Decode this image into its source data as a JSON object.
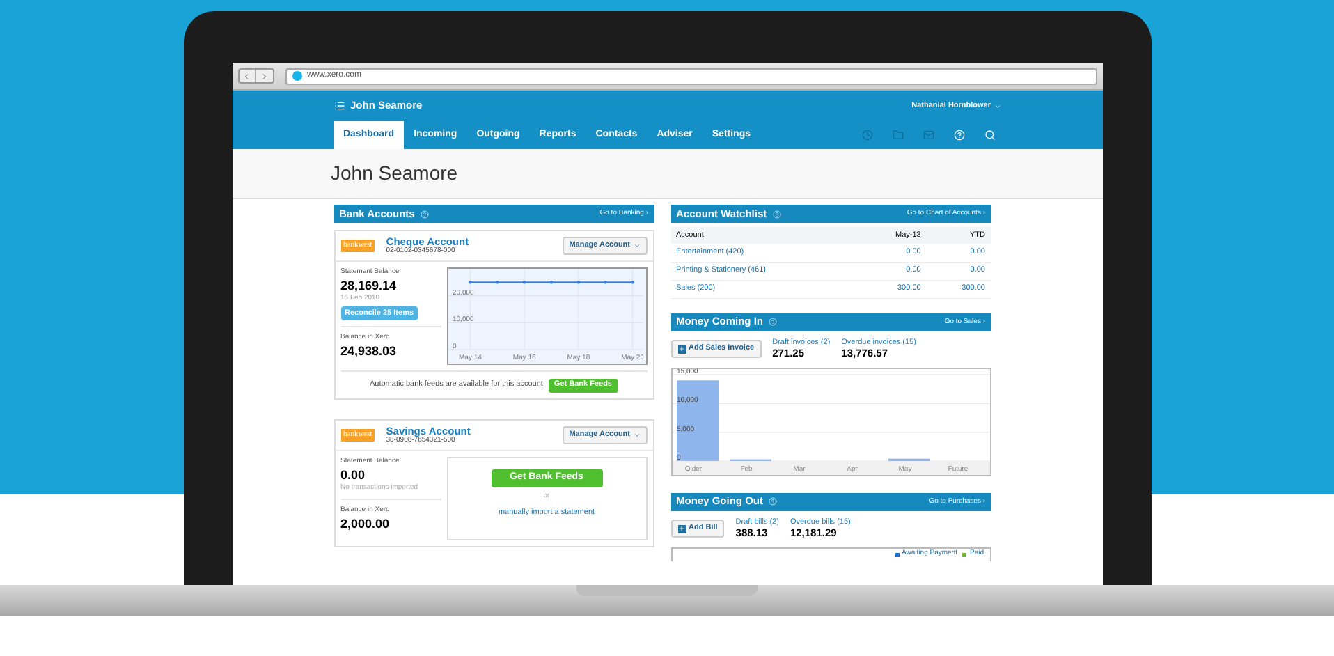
{
  "browser": {
    "url": "www.xero.com"
  },
  "nav": {
    "org": "John Seamore",
    "user": "Nathanial Hornblower",
    "tabs": [
      {
        "label": "Dashboard",
        "selected": true
      },
      {
        "label": "Incoming",
        "selected": false
      },
      {
        "label": "Outgoing",
        "selected": false
      },
      {
        "label": "Reports",
        "selected": false
      },
      {
        "label": "Contacts",
        "selected": false
      },
      {
        "label": "Adviser",
        "selected": false
      },
      {
        "label": "Settings",
        "selected": false
      }
    ]
  },
  "page_title": "John Seamore",
  "bank_accounts": {
    "title": "Bank Accounts",
    "link": "Go to Banking ›",
    "accounts": [
      {
        "kind": "reconcile",
        "bank": "bankwest",
        "name": "Cheque Account",
        "number": "02-0102-0345678-000",
        "manage": "Manage Account",
        "statement_label": "Statement Balance",
        "statement_balance": "28,169.14",
        "date": "16 Feb 2010",
        "reconcile_button": "Reconcile 25 Items",
        "xero_label": "Balance in Xero",
        "xero_balance": "24,938.03",
        "footer_text": "Automatic bank feeds are available for this account",
        "feed_button": "Get Bank Feeds",
        "chart_data": {
          "type": "line",
          "categories": [
            "May 14",
            null,
            "May 16",
            null,
            "May 18",
            null,
            "May 20"
          ],
          "yticks": [
            {
              "value": 0,
              "label": "0"
            },
            {
              "value": 10000,
              "label": "10,000"
            },
            {
              "value": 20000,
              "label": "20,000"
            }
          ],
          "ylim": [
            0,
            30000
          ],
          "grid": true,
          "series": [
            {
              "color": "#3b82e0",
              "values": [
                25000,
                25000,
                25000,
                25000,
                25000,
                25000,
                25000
              ]
            }
          ]
        }
      },
      {
        "kind": "import",
        "bank": "bankwest",
        "name": "Savings Account",
        "number": "38-0908-7654321-500",
        "manage": "Manage Account",
        "statement_label": "Statement Balance",
        "statement_balance": "0.00",
        "note": "No transactions imported",
        "xero_label": "Balance in Xero",
        "xero_balance": "2,000.00",
        "feed_button": "Get Bank Feeds",
        "or_text": "or",
        "import_link": "manually import a statement"
      }
    ]
  },
  "watchlist": {
    "title": "Account Watchlist",
    "link": "Go to Chart of Accounts ›",
    "columns": [
      "Account",
      "May-13",
      "YTD"
    ],
    "rows": [
      [
        "Entertainment (420)",
        "0.00",
        "0.00"
      ],
      [
        "Printing & Stationery (461)",
        "0.00",
        "0.00"
      ],
      [
        "Sales (200)",
        "300.00",
        "300.00"
      ]
    ]
  },
  "money_in": {
    "title": "Money Coming In",
    "link": "Go to Sales ›",
    "add_button": "Add Sales Invoice",
    "stats": [
      {
        "label": "Draft invoices (2)",
        "value": "271.25"
      },
      {
        "label": "Overdue invoices (15)",
        "value": "13,776.57"
      }
    ],
    "chart_data": {
      "type": "bar",
      "categories": [
        "Older",
        "Feb",
        "Mar",
        "Apr",
        "May",
        "Future"
      ],
      "yticks": [
        {
          "value": 0,
          "label": "0"
        },
        {
          "value": 5000,
          "label": "5,000"
        },
        {
          "value": 10000,
          "label": "10,000"
        },
        {
          "value": 15000,
          "label": "15,000"
        }
      ],
      "ylim": [
        0,
        15000
      ],
      "series": [
        {
          "color": "#8fb6ec",
          "values": [
            14000,
            300,
            0,
            0,
            400,
            0
          ]
        }
      ]
    }
  },
  "money_out": {
    "title": "Money Going Out",
    "link": "Go to Purchases ›",
    "add_button": "Add Bill",
    "stats": [
      {
        "label": "Draft bills (2)",
        "value": "388.13"
      },
      {
        "label": "Overdue bills (15)",
        "value": "12,181.29"
      }
    ],
    "legend": [
      {
        "label": "Awaiting Payment",
        "color": "#1f6fd1"
      },
      {
        "label": "Paid",
        "color": "#6bb33a"
      }
    ]
  }
}
